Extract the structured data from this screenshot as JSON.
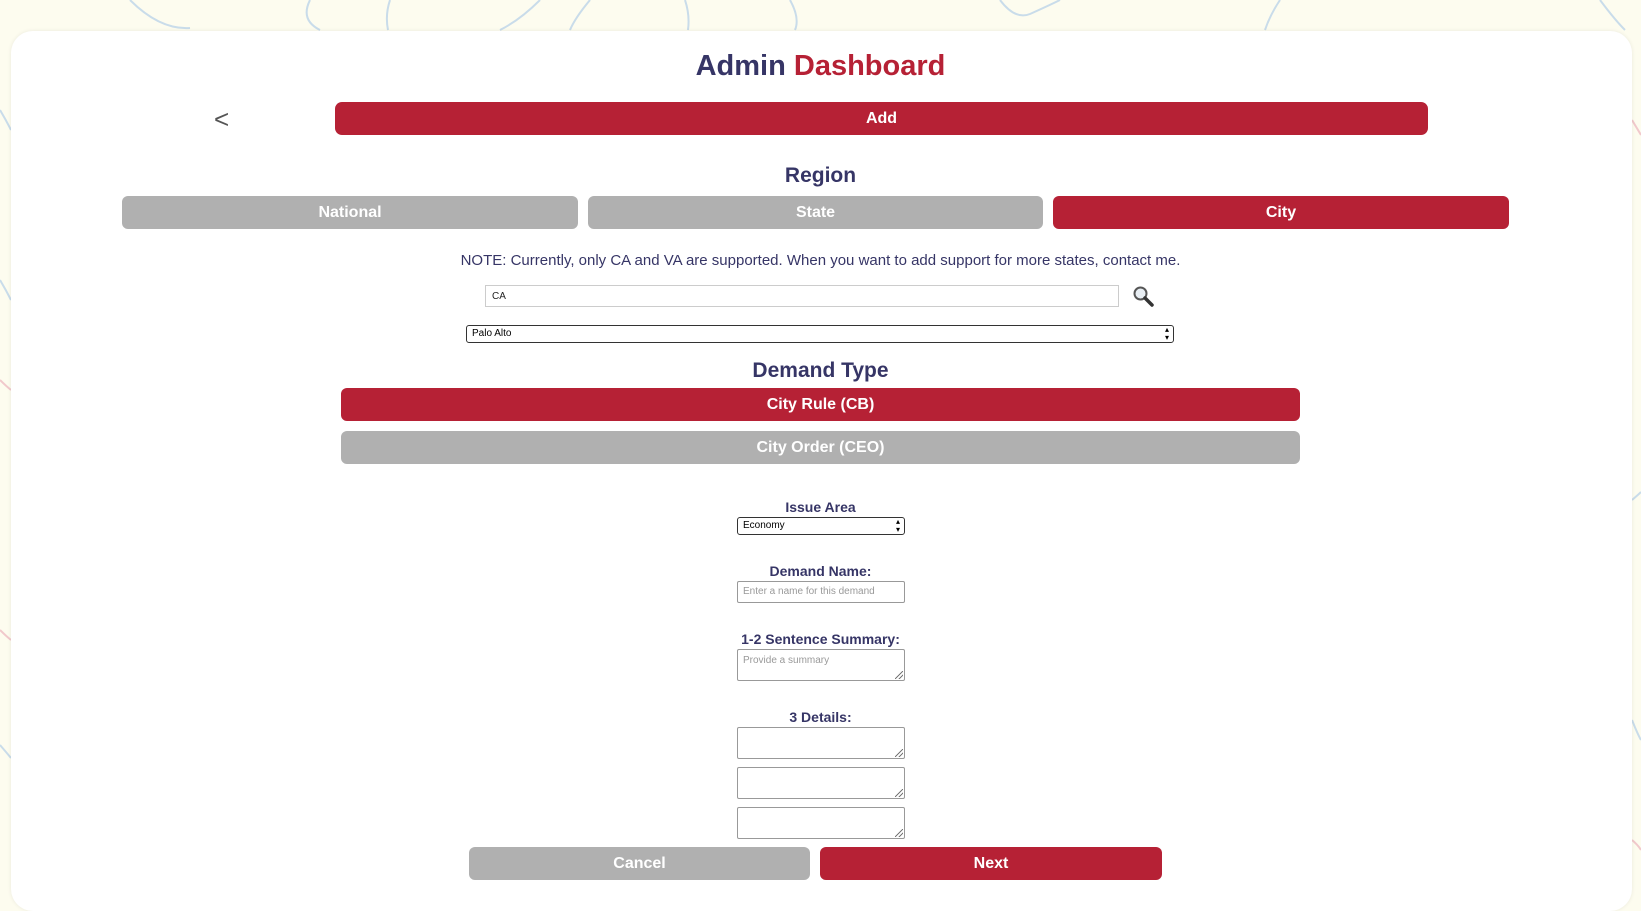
{
  "header": {
    "title_part1": "Admin",
    "title_part2": "Dashboard",
    "back_label": "<"
  },
  "add_label": "Add",
  "region": {
    "heading": "Region",
    "options": [
      {
        "label": "National",
        "selected": false
      },
      {
        "label": "State",
        "selected": false
      },
      {
        "label": "City",
        "selected": true
      }
    ]
  },
  "note": "NOTE: Currently, only CA and VA are supported. When you want to add support for more states, contact me.",
  "state_search": {
    "value": "CA",
    "icon": "search-icon"
  },
  "city_select": {
    "value": "Palo Alto"
  },
  "demand_type": {
    "heading": "Demand Type",
    "options": [
      {
        "label": "City Rule (CB)",
        "selected": true
      },
      {
        "label": "City Order (CEO)",
        "selected": false
      }
    ]
  },
  "issue_area": {
    "label": "Issue Area",
    "value": "Economy"
  },
  "demand_name": {
    "label": "Demand Name:",
    "placeholder": "Enter a name for this demand"
  },
  "summary": {
    "label": "1-2 Sentence Summary:",
    "placeholder": "Provide a summary"
  },
  "details": {
    "label": "3 Details:"
  },
  "actions": {
    "cancel_label": "Cancel",
    "next_label": "Next"
  },
  "colors": {
    "accent": "#b62135",
    "navy": "#363566",
    "inactive": "#b0b0b0",
    "background": "#fdfcef"
  }
}
